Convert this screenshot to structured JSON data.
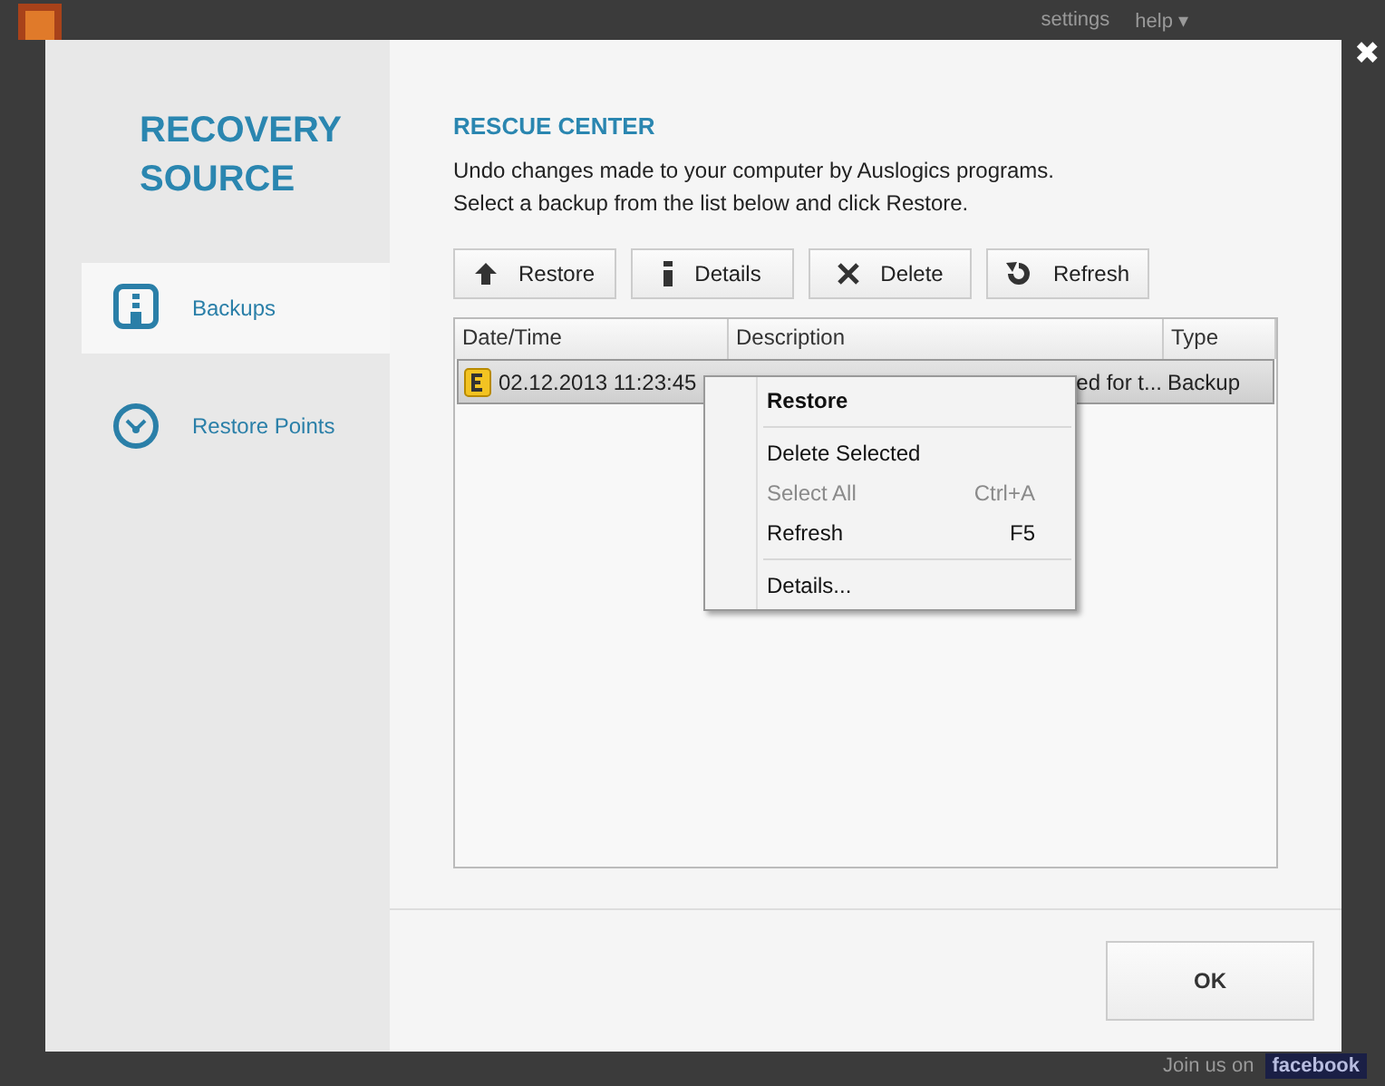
{
  "background_app": {
    "menu_links": [
      {
        "label": "settings"
      },
      {
        "label": "help ▾"
      }
    ],
    "footer": {
      "text": "Join us on",
      "link": "facebook"
    }
  },
  "dialog": {
    "sidebar": {
      "title_lines": [
        "RECOVERY",
        "SOURCE"
      ],
      "items": [
        {
          "label": "Backups",
          "kind": "backups",
          "selected": true
        },
        {
          "label": "Restore Points",
          "kind": "points",
          "selected": false
        }
      ]
    },
    "heading": "RESCUE CENTER",
    "description_lines": [
      "Undo changes made to your computer by Auslogics programs.",
      "Select a backup from the list below and click Restore."
    ],
    "toolbar": [
      {
        "label": "Restore",
        "kind": "up"
      },
      {
        "label": "Details",
        "kind": "info"
      },
      {
        "label": "Delete",
        "kind": "delete"
      },
      {
        "label": "Refresh",
        "kind": "refresh"
      }
    ],
    "table": {
      "columns": [
        "Date/Time",
        "Description",
        "Type"
      ],
      "rows": [
        {
          "date": "02.12.2013 11:23:45",
          "description": "ed for t...",
          "type": "Backup",
          "selected": true
        }
      ]
    },
    "context_menu": [
      {
        "kind": "item",
        "label": "Restore",
        "bold": true,
        "disabled": false
      },
      {
        "kind": "separator"
      },
      {
        "kind": "item",
        "label": "Delete Selected",
        "bold": false,
        "disabled": false
      },
      {
        "kind": "item",
        "label": "Select All",
        "shortcut": "Ctrl+A",
        "bold": false,
        "disabled": true
      },
      {
        "kind": "item",
        "label": "Refresh",
        "shortcut": "F5",
        "bold": false,
        "disabled": false
      },
      {
        "kind": "separator"
      },
      {
        "kind": "item",
        "label": "Details...",
        "bold": false,
        "disabled": false
      }
    ],
    "ok_button": "OK",
    "close_symbol": "✖"
  }
}
